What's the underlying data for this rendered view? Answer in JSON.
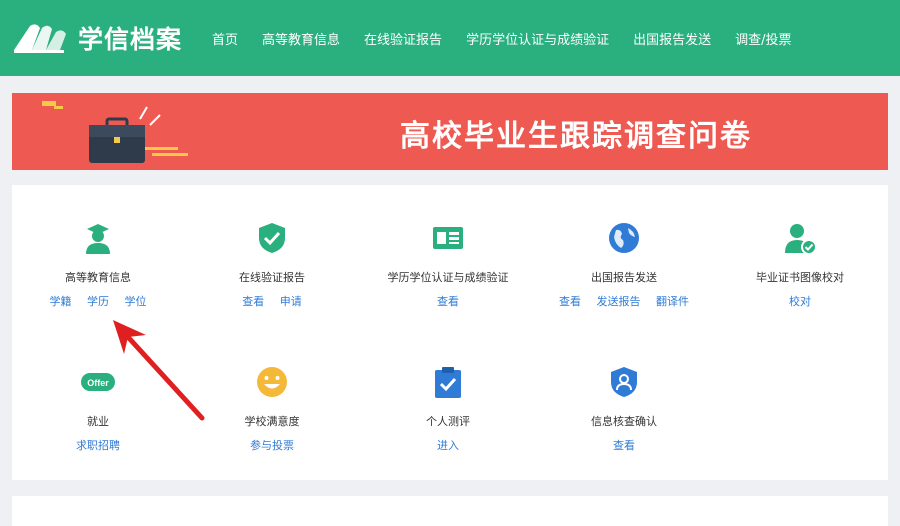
{
  "header": {
    "logo_text": "学信档案",
    "nav": [
      "首页",
      "高等教育信息",
      "在线验证报告",
      "学历学位认证与成绩验证",
      "出国报告发送",
      "调查/投票"
    ]
  },
  "banner": {
    "title": "高校毕业生跟踪调查问卷"
  },
  "services": [
    {
      "name": "高等教育信息",
      "icon": "graduate-icon",
      "links": [
        "学籍",
        "学历",
        "学位"
      ]
    },
    {
      "name": "在线验证报告",
      "icon": "shield-check-icon",
      "links": [
        "查看",
        "申请"
      ]
    },
    {
      "name": "学历学位认证与成绩验证",
      "icon": "id-card-icon",
      "links": [
        "查看"
      ]
    },
    {
      "name": "出国报告发送",
      "icon": "globe-icon",
      "links": [
        "查看",
        "发送报告",
        "翻译件"
      ]
    },
    {
      "name": "毕业证书图像校对",
      "icon": "user-check-icon",
      "links": [
        "校对"
      ]
    },
    {
      "name": "就业",
      "icon": "offer-icon",
      "icon_text": "Offer",
      "links": [
        "求职招聘"
      ]
    },
    {
      "name": "学校满意度",
      "icon": "smile-icon",
      "links": [
        "参与投票"
      ]
    },
    {
      "name": "个人测评",
      "icon": "clipboard-check-icon",
      "links": [
        "进入"
      ]
    },
    {
      "name": "信息核查确认",
      "icon": "shield-user-icon",
      "links": [
        "查看"
      ]
    }
  ],
  "colors": {
    "brand": "#2ab07f",
    "banner": "#ee5a52",
    "link": "#2f7bd6",
    "arrow": "#e02020"
  }
}
